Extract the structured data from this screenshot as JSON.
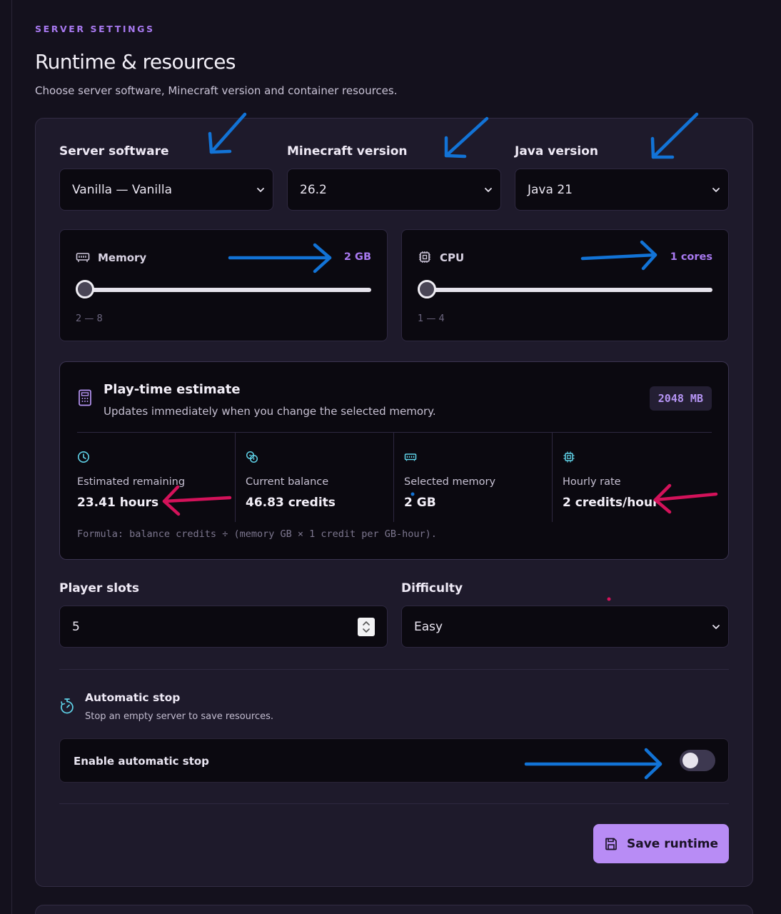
{
  "header": {
    "eyebrow": "SERVER SETTINGS",
    "title": "Runtime & resources",
    "subtitle": "Choose server software, Minecraft version and container resources."
  },
  "selects": {
    "software": {
      "label": "Server software",
      "value": "Vanilla — Vanilla"
    },
    "minecraft": {
      "label": "Minecraft version",
      "value": "26.2"
    },
    "java": {
      "label": "Java version",
      "value": "Java 21"
    }
  },
  "resources": {
    "memory": {
      "label": "Memory",
      "value": "2 GB",
      "range": "2 — 8",
      "level": 0
    },
    "cpu": {
      "label": "CPU",
      "value": "1 cores",
      "range": "1 — 4",
      "level": 0
    }
  },
  "estimate": {
    "title": "Play-time estimate",
    "subtitle": "Updates immediately when you change the selected memory.",
    "badge": "2048 MB",
    "stats": [
      {
        "icon": "clock-icon",
        "label": "Estimated remaining",
        "value": "23.41 hours"
      },
      {
        "icon": "coins-icon",
        "label": "Current balance",
        "value": "46.83 credits"
      },
      {
        "icon": "memory-icon",
        "label": "Selected memory",
        "value": "2 GB"
      },
      {
        "icon": "cpu-icon",
        "label": "Hourly rate",
        "value": "2 credits/hour"
      }
    ],
    "formula": "Formula: balance credits ÷ (memory GB × 1 credit per GB-hour)."
  },
  "player_slots": {
    "label": "Player slots",
    "value": "5"
  },
  "difficulty": {
    "label": "Difficulty",
    "value": "Easy"
  },
  "autostop": {
    "title": "Automatic stop",
    "subtitle": "Stop an empty server to save resources.",
    "toggle_label": "Enable automatic stop",
    "enabled": false
  },
  "actions": {
    "save_label": "Save runtime"
  },
  "colors": {
    "accent": "#a879f0",
    "button": "#b88cf5",
    "annotation_blue": "#1273d6",
    "annotation_pink": "#d3125a"
  }
}
